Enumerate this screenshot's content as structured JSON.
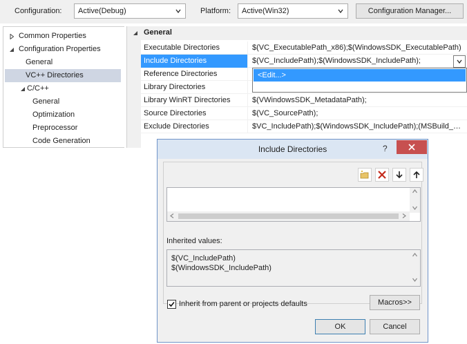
{
  "topbar": {
    "configuration_label": "Configuration:",
    "configuration_value": "Active(Debug)",
    "platform_label": "Platform:",
    "platform_value": "Active(Win32)",
    "config_manager_button": "Configuration Manager..."
  },
  "tree": {
    "items": [
      {
        "label": "Common Properties",
        "level": 0,
        "expander": "collapsed"
      },
      {
        "label": "Configuration Properties",
        "level": 0,
        "expander": "expanded"
      },
      {
        "label": "General",
        "level": 1
      },
      {
        "label": "VC++ Directories",
        "level": 1,
        "selected": true
      },
      {
        "label": "C/C++",
        "level": 1,
        "expander": "expanded"
      },
      {
        "label": "General",
        "level": 2
      },
      {
        "label": "Optimization",
        "level": 2
      },
      {
        "label": "Preprocessor",
        "level": 2
      },
      {
        "label": "Code Generation",
        "level": 2
      }
    ]
  },
  "grid": {
    "category": "General",
    "rows": [
      {
        "name": "Executable Directories",
        "value": "$(VC_ExecutablePath_x86);$(WindowsSDK_ExecutablePath)"
      },
      {
        "name": "Include Directories",
        "value": "$(VC_IncludePath);$(WindowsSDK_IncludePath);",
        "selected": true
      },
      {
        "name": "Reference Directories",
        "value": ""
      },
      {
        "name": "Library Directories",
        "value": ""
      },
      {
        "name": "Library WinRT Directories",
        "value": "$(VWindowsSDK_MetadataPath);"
      },
      {
        "name": "Source Directories",
        "value": "$(VC_SourcePath);"
      },
      {
        "name": "Exclude Directories",
        "value": "$VC_IncludePath);$(WindowsSDK_IncludePath);(MSBuild_ExecutablePath)"
      }
    ],
    "dropdown_item": "<Edit...>"
  },
  "dialog": {
    "title": "Include Directories",
    "help_glyph": "?",
    "inherited_label": "Inherited values:",
    "inherited_values": [
      "$(VC_IncludePath)",
      "$(WindowsSDK_IncludePath)"
    ],
    "inherit_checkbox_label": "Inherit from parent or projects defaults",
    "inherit_checked": true,
    "macros_button": "Macros>>",
    "ok_button": "OK",
    "cancel_button": "Cancel"
  },
  "colors": {
    "selection": "#3399ff",
    "tree_selection": "#cfd6e3",
    "close_button": "#c75050",
    "delete_icon": "#c42b1c"
  }
}
